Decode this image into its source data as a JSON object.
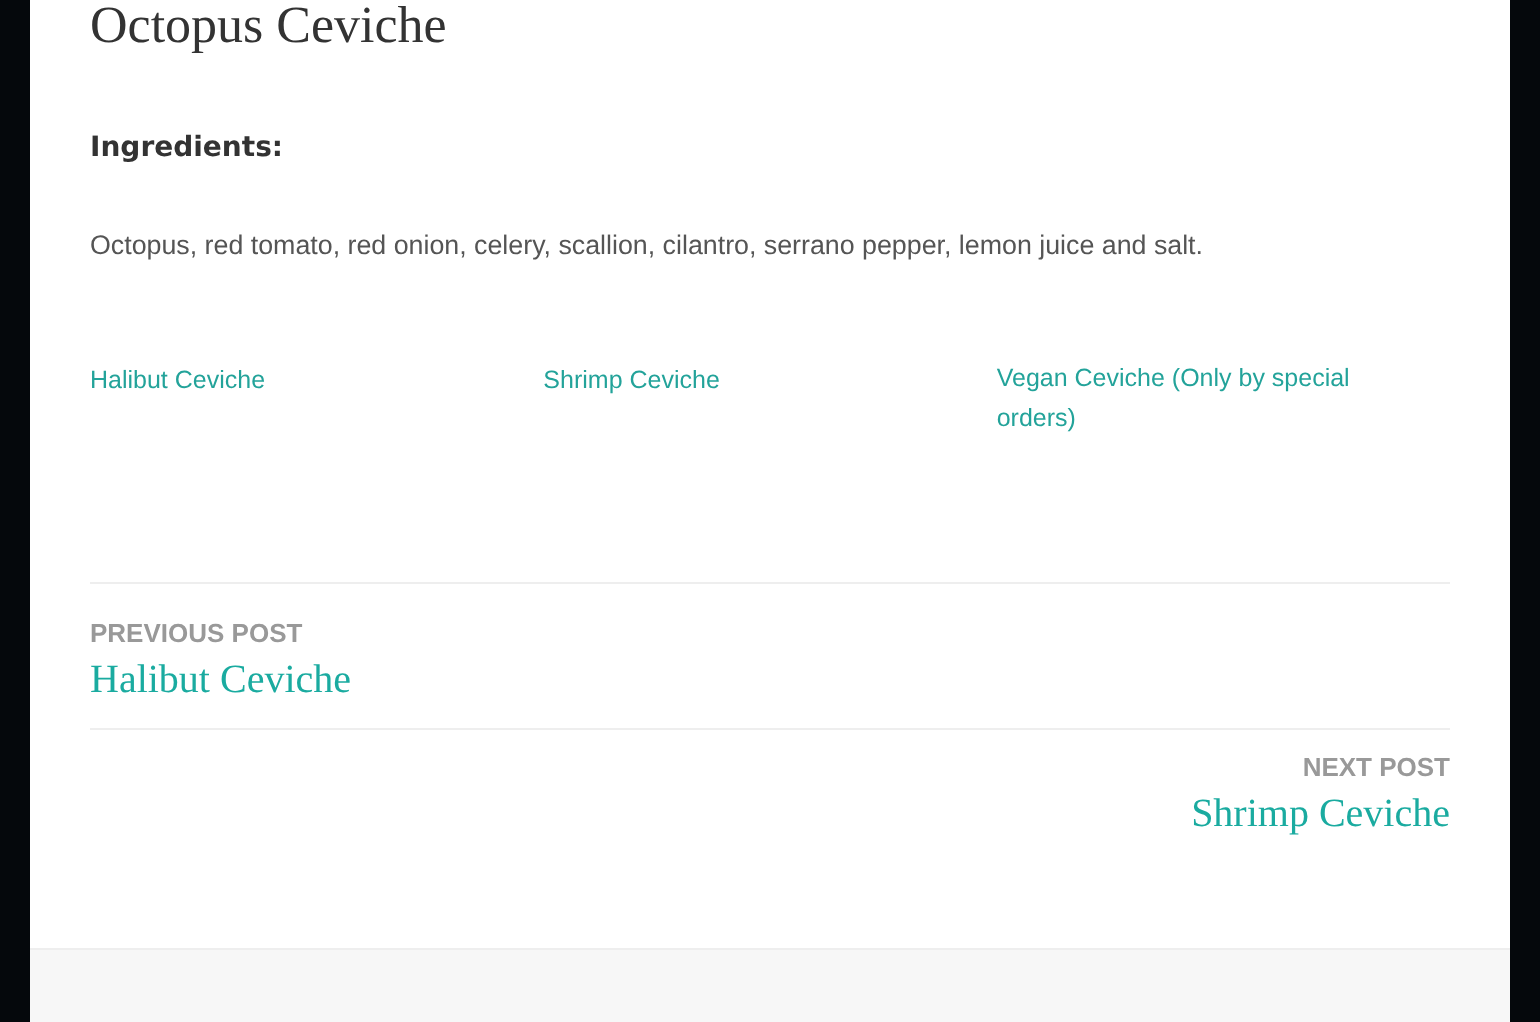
{
  "post": {
    "title": "Octopus Ceviche",
    "ingredients_label": "Ingredients:",
    "ingredients": "Octopus, red tomato, red onion, celery, scallion, cilantro, serrano pepper, lemon juice and salt."
  },
  "related": [
    "Halibut Ceviche",
    "Shrimp Ceviche",
    "Vegan Ceviche (Only by special orders)"
  ],
  "navigation": [
    {
      "kind": "previous",
      "label": "PREVIOUS POST",
      "title": "Halibut Ceviche"
    },
    {
      "kind": "next",
      "label": "NEXT POST",
      "title": "Shrimp Ceviche"
    }
  ]
}
